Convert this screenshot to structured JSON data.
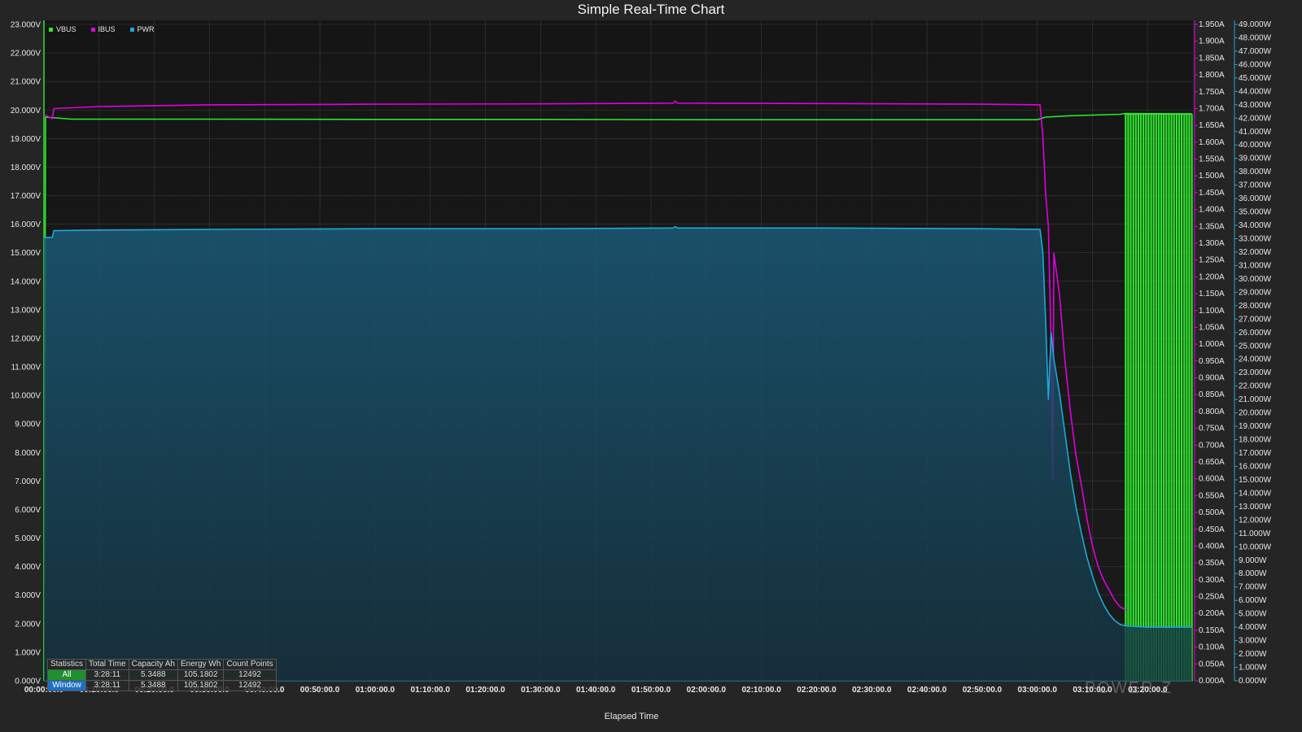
{
  "chart_data": {
    "type": "line",
    "title": "Simple Real-Time Chart",
    "xlabel": "Elapsed Time",
    "x_tick_labels": [
      "00:00:00.0",
      "00:10:00.0",
      "00:20:00.0",
      "00:30:00.0",
      "00:40:00.0",
      "00:50:00.0",
      "01:00:00.0",
      "01:10:00.0",
      "01:20:00.0",
      "01:30:00.0",
      "01:40:00.0",
      "01:50:00.0",
      "02:00:00.0",
      "02:10:00.0",
      "02:20:00.0",
      "02:30:00.0",
      "02:40:00.0",
      "02:50:00.0",
      "03:00:00.0",
      "03:10:00.0",
      "03:20:00.0"
    ],
    "x_range_minutes": [
      0,
      208.2
    ],
    "y_left": {
      "unit": "V",
      "range": [
        0,
        23
      ],
      "tick_labels": [
        "0.000V",
        "1.000V",
        "2.000V",
        "3.000V",
        "4.000V",
        "5.000V",
        "6.000V",
        "7.000V",
        "8.000V",
        "9.000V",
        "10.000V",
        "11.000V",
        "12.000V",
        "13.000V",
        "14.000V",
        "15.000V",
        "16.000V",
        "17.000V",
        "18.000V",
        "19.000V",
        "20.000V",
        "21.000V",
        "22.000V",
        "23.000V"
      ]
    },
    "y_right_current": {
      "unit": "A",
      "range": [
        0,
        1.95
      ],
      "tick_labels": [
        "0.000A",
        "0.050A",
        "0.100A",
        "0.150A",
        "0.200A",
        "0.250A",
        "0.300A",
        "0.350A",
        "0.400A",
        "0.450A",
        "0.500A",
        "0.550A",
        "0.600A",
        "0.650A",
        "0.700A",
        "0.750A",
        "0.800A",
        "0.850A",
        "0.900A",
        "0.950A",
        "1.000A",
        "1.050A",
        "1.100A",
        "1.150A",
        "1.200A",
        "1.250A",
        "1.300A",
        "1.350A",
        "1.400A",
        "1.450A",
        "1.500A",
        "1.550A",
        "1.600A",
        "1.650A",
        "1.700A",
        "1.750A",
        "1.800A",
        "1.850A",
        "1.900A",
        "1.950A"
      ]
    },
    "y_right_power": {
      "unit": "W",
      "range": [
        0,
        49
      ],
      "tick_labels": [
        "0.000W",
        "1.000W",
        "2.000W",
        "3.000W",
        "4.000W",
        "5.000W",
        "6.000W",
        "7.000W",
        "8.000W",
        "9.000W",
        "10.000W",
        "11.000W",
        "12.000W",
        "13.000W",
        "14.000W",
        "15.000W",
        "16.000W",
        "17.000W",
        "18.000W",
        "19.000W",
        "20.000W",
        "21.000W",
        "22.000W",
        "23.000W",
        "24.000W",
        "25.000W",
        "26.000W",
        "27.000W",
        "28.000W",
        "29.000W",
        "30.000W",
        "31.000W",
        "32.000W",
        "33.000W",
        "34.000W",
        "35.000W",
        "36.000W",
        "37.000W",
        "38.000W",
        "39.000W",
        "40.000W",
        "41.000W",
        "42.000W",
        "43.000W",
        "44.000W",
        "45.000W",
        "46.000W",
        "47.000W",
        "48.000W",
        "49.000W"
      ]
    },
    "grid": true,
    "legend_position": "top-left",
    "series": [
      {
        "name": "VBUS",
        "axis": "left",
        "color": "#2ee62e",
        "points": [
          [
            0,
            0
          ],
          [
            0.3,
            19.75
          ],
          [
            5,
            19.68
          ],
          [
            30,
            19.68
          ],
          [
            60,
            19.67
          ],
          [
            90,
            19.67
          ],
          [
            120,
            19.66
          ],
          [
            150,
            19.66
          ],
          [
            180,
            19.66
          ],
          [
            181.5,
            19.75
          ],
          [
            186,
            19.8
          ],
          [
            195,
            19.85
          ],
          [
            196,
            19.88
          ],
          [
            208,
            19.86
          ]
        ],
        "toggle_region": {
          "x_from": 196,
          "x_to": 208,
          "high": 19.86,
          "low": 0,
          "count": 26
        }
      },
      {
        "name": "IBUS",
        "axis": "y_right_current",
        "color": "#e000e0",
        "points": [
          [
            0,
            1.68
          ],
          [
            0.3,
            1.68
          ],
          [
            1.5,
            1.67
          ],
          [
            1.8,
            1.7
          ],
          [
            10,
            1.706
          ],
          [
            30,
            1.711
          ],
          [
            60,
            1.713
          ],
          [
            90,
            1.714
          ],
          [
            114,
            1.716
          ],
          [
            114.4,
            1.722
          ],
          [
            114.8,
            1.716
          ],
          [
            140,
            1.715
          ],
          [
            170,
            1.713
          ],
          [
            180.5,
            1.711
          ],
          [
            181,
            1.62
          ],
          [
            181.5,
            1.45
          ],
          [
            182,
            1.35
          ],
          [
            182.5,
            1.0
          ],
          [
            182.8,
            0.6
          ],
          [
            183,
            1.27
          ],
          [
            184,
            1.15
          ],
          [
            185,
            0.95
          ],
          [
            186,
            0.8
          ],
          [
            187,
            0.67
          ],
          [
            188,
            0.58
          ],
          [
            189,
            0.48
          ],
          [
            190,
            0.4
          ],
          [
            191,
            0.34
          ],
          [
            192,
            0.3
          ],
          [
            193,
            0.27
          ],
          [
            194,
            0.24
          ],
          [
            195,
            0.22
          ],
          [
            196,
            0.21
          ]
        ]
      },
      {
        "name": "PWR",
        "axis": "y_right_power",
        "color": "#1ea8d8",
        "points": [
          [
            0,
            33.1
          ],
          [
            1.5,
            33.1
          ],
          [
            1.8,
            33.6
          ],
          [
            10,
            33.65
          ],
          [
            30,
            33.7
          ],
          [
            60,
            33.75
          ],
          [
            90,
            33.75
          ],
          [
            114,
            33.8
          ],
          [
            114.4,
            33.9
          ],
          [
            114.8,
            33.8
          ],
          [
            140,
            33.8
          ],
          [
            170,
            33.75
          ],
          [
            180.5,
            33.7
          ],
          [
            181,
            32.0
          ],
          [
            181.5,
            27.0
          ],
          [
            182,
            21.0
          ],
          [
            182.5,
            26.0
          ],
          [
            183,
            24.0
          ],
          [
            184,
            21.5
          ],
          [
            185,
            18.5
          ],
          [
            186,
            15.5
          ],
          [
            187,
            13.0
          ],
          [
            188,
            11.0
          ],
          [
            189,
            9.2
          ],
          [
            190,
            7.8
          ],
          [
            191,
            6.6
          ],
          [
            192,
            5.7
          ],
          [
            193,
            5.0
          ],
          [
            194,
            4.5
          ],
          [
            195,
            4.2
          ],
          [
            196,
            4.1
          ],
          [
            200,
            4.0
          ],
          [
            204,
            4.0
          ],
          [
            208,
            4.0
          ]
        ]
      }
    ]
  },
  "legend": {
    "vbus": "VBUS",
    "ibus": "IBUS",
    "pwr": "PWR"
  },
  "stats": {
    "headers": [
      "Statistics",
      "Total Time",
      "Capacity Ah",
      "Energy Wh",
      "Count Points"
    ],
    "all": [
      "All",
      "3:28:11",
      "5.3488",
      "105.1802",
      "12492"
    ],
    "window": [
      "Window",
      "3:28:11",
      "5.3488",
      "105.1802",
      "12492"
    ]
  },
  "watermark": "POWER-Z"
}
